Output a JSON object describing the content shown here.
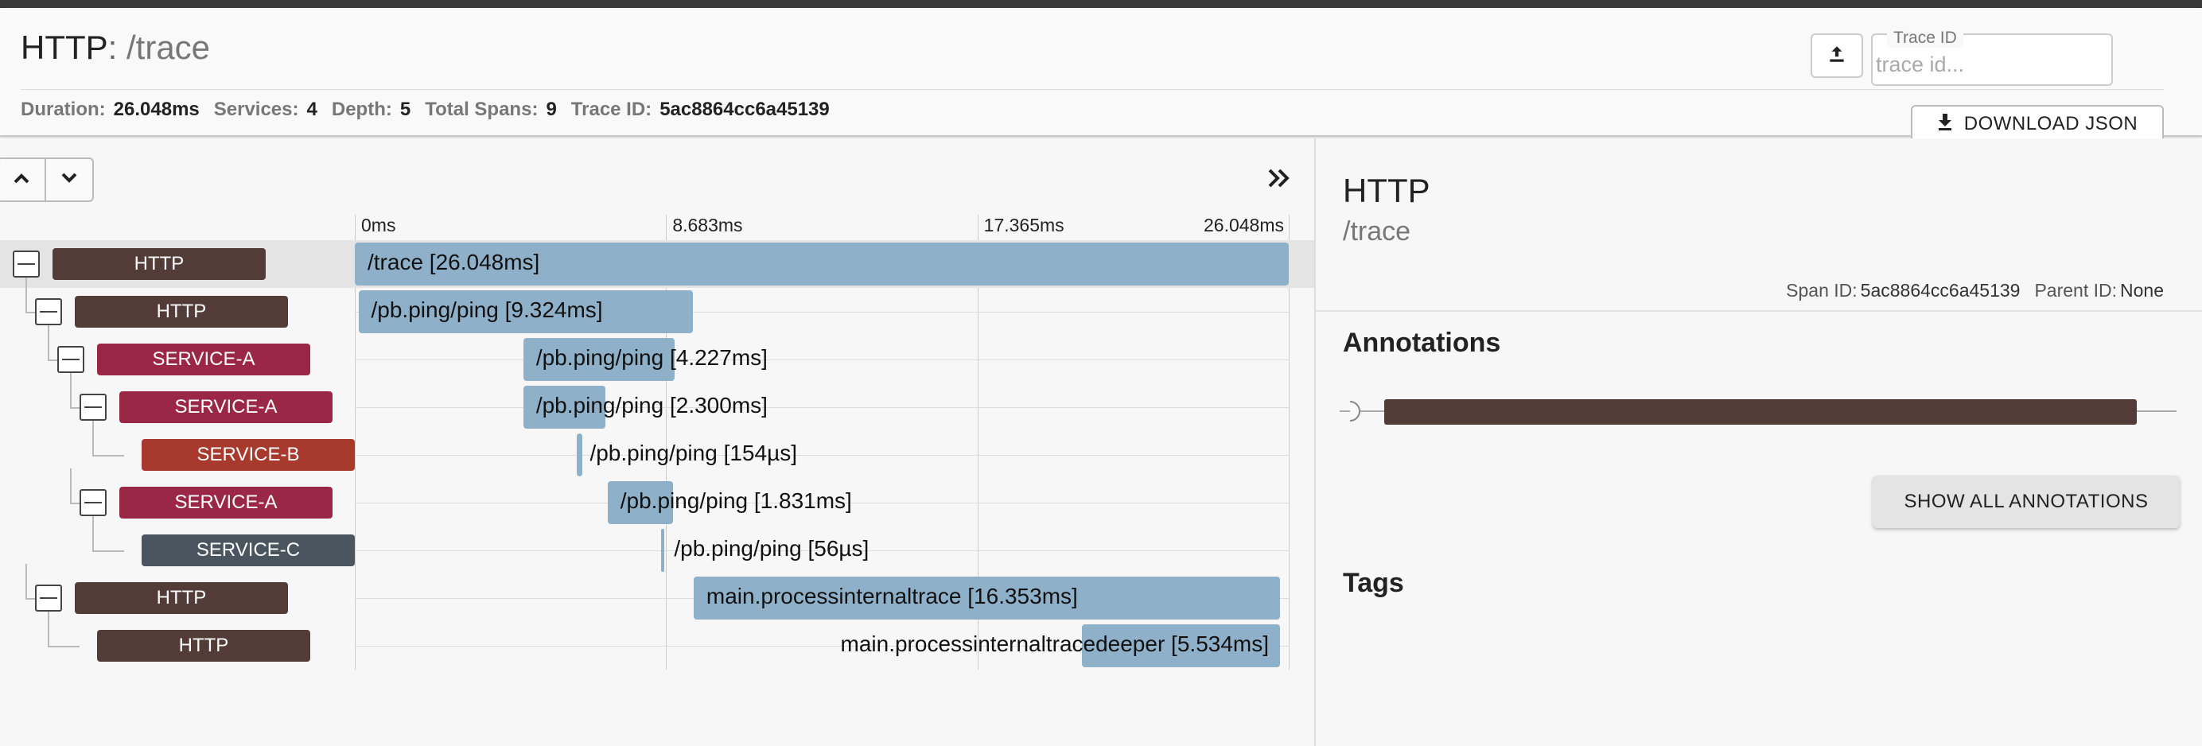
{
  "header": {
    "service": "HTTP",
    "separator": ": ",
    "span_name": "/trace",
    "stats": [
      {
        "label": "Duration:",
        "value": "26.048ms"
      },
      {
        "label": "Services:",
        "value": "4"
      },
      {
        "label": "Depth:",
        "value": "5"
      },
      {
        "label": "Total Spans:",
        "value": "9"
      },
      {
        "label": "Trace ID:",
        "value": "5ac8864cc6a45139"
      }
    ],
    "trace_id_label": "Trace ID",
    "trace_id_placeholder": "trace id...",
    "download_label": "DOWNLOAD JSON",
    "icons": {
      "upload": "upload-icon",
      "download": "download-icon"
    }
  },
  "timeline": {
    "ticks": [
      "0ms",
      "8.683ms",
      "17.365ms",
      "26.048ms"
    ],
    "icons": {
      "expand_up": "chevron-up-icon",
      "expand_down": "chevron-down-icon",
      "collapse_all": "double-chevron-right-icon"
    },
    "rows": [
      {
        "service": "HTTP",
        "label": "/trace [26.048ms]",
        "color": "#533b37",
        "depth": 0,
        "collapsible": true,
        "selected": true,
        "start_ms": 0,
        "duration_ms": 26.048
      },
      {
        "service": "HTTP",
        "label": "/pb.ping/ping [9.324ms]",
        "color": "#533b37",
        "depth": 1,
        "collapsible": true,
        "selected": false,
        "start_ms": 0.1,
        "duration_ms": 9.324
      },
      {
        "service": "SERVICE-A",
        "label": "/pb.ping/ping [4.227ms]",
        "color": "#9b2747",
        "depth": 2,
        "collapsible": true,
        "selected": false,
        "start_ms": 4.7,
        "duration_ms": 4.227
      },
      {
        "service": "SERVICE-A",
        "label": "/pb.ping/ping [2.300ms]",
        "color": "#9b2747",
        "depth": 3,
        "collapsible": true,
        "selected": false,
        "start_ms": 4.7,
        "duration_ms": 2.3
      },
      {
        "service": "SERVICE-B",
        "label": "/pb.ping/ping [154µs]",
        "color": "#a83a2d",
        "depth": 4,
        "collapsible": false,
        "selected": false,
        "start_ms": 6.2,
        "duration_ms": 0.154
      },
      {
        "service": "SERVICE-A",
        "label": "/pb.ping/ping [1.831ms]",
        "color": "#9b2747",
        "depth": 3,
        "collapsible": true,
        "selected": false,
        "start_ms": 7.05,
        "duration_ms": 1.831
      },
      {
        "service": "SERVICE-C",
        "label": "/pb.ping/ping [56µs]",
        "color": "#4a5560",
        "depth": 4,
        "collapsible": false,
        "selected": false,
        "start_ms": 8.55,
        "duration_ms": 0.056
      },
      {
        "service": "HTTP",
        "label": "main.processinternaltrace [16.353ms]",
        "color": "#533b37",
        "depth": 1,
        "collapsible": true,
        "selected": false,
        "start_ms": 9.45,
        "duration_ms": 16.353
      },
      {
        "service": "HTTP",
        "label": "main.processinternaltracedeeper [5.534ms]",
        "color": "#533b37",
        "depth": 2,
        "collapsible": false,
        "selected": false,
        "start_ms": 20.27,
        "duration_ms": 5.534
      }
    ]
  },
  "detail": {
    "service": "HTTP",
    "span_name": "/trace",
    "span_id_label": "Span ID:",
    "span_id": "5ac8864cc6a45139",
    "parent_id_label": "Parent ID:",
    "parent_id": "None",
    "annotations_title": "Annotations",
    "annotation_bar_color": "#533b37",
    "show_all_label": "SHOW ALL ANNOTATIONS",
    "tags_title": "Tags"
  }
}
